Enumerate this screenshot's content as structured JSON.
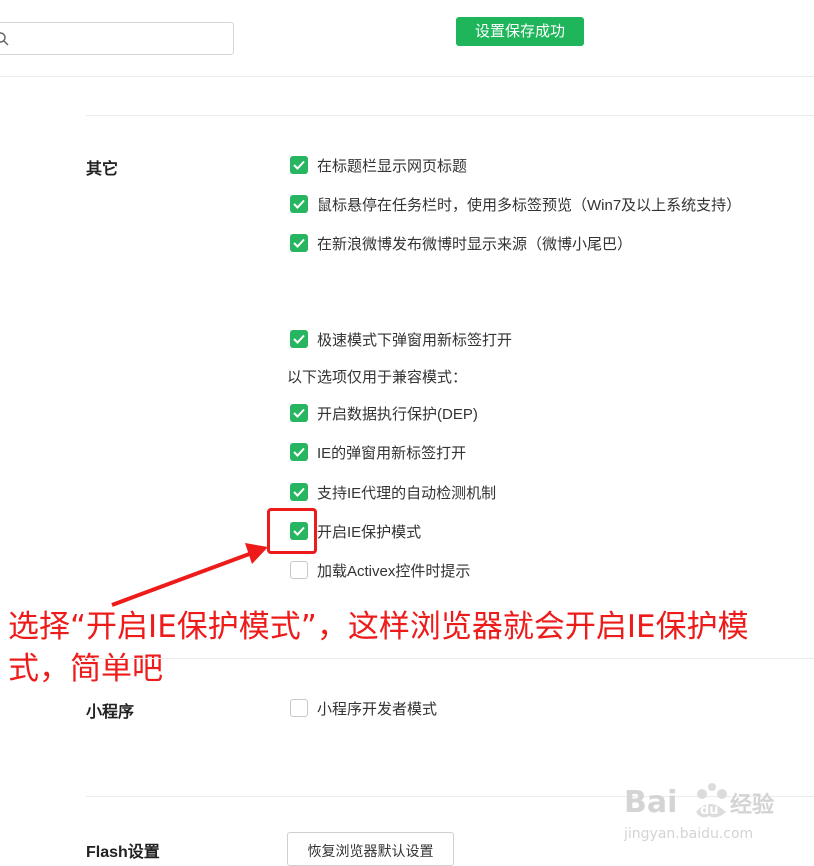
{
  "search": {
    "placeholder": "",
    "value": ""
  },
  "toast": {
    "label": "设置保存成功",
    "color": "#1fb55a"
  },
  "other_section": {
    "title": "其它",
    "options": [
      {
        "label": "在标题栏显示网页标题",
        "checked": true
      },
      {
        "label": "鼠标悬停在任务栏时，使用多标签预览（Win7及以上系统支持）",
        "checked": true
      },
      {
        "label": "在新浪微博发布微博时显示来源（微博小尾巴）",
        "checked": true
      }
    ],
    "speed_mode_option": {
      "label": "极速模式下弹窗用新标签打开",
      "checked": true
    },
    "compat_heading": "以下选项仅用于兼容模式：",
    "compat_options": [
      {
        "label": "开启数据执行保护(DEP)",
        "checked": true
      },
      {
        "label": "IE的弹窗用新标签打开",
        "checked": true
      },
      {
        "label": "支持IE代理的自动检测机制",
        "checked": true
      },
      {
        "label": "开启IE保护模式",
        "checked": true
      },
      {
        "label": "加载Activex控件时提示",
        "checked": false
      }
    ]
  },
  "annotation": {
    "text": "选择“开启IE保护模式”，这样浏览器就会开启IE保护模式，简单吧",
    "color": "#ee1b1b"
  },
  "miniprogram_section": {
    "title": "小程序",
    "option": {
      "label": "小程序开发者模式",
      "checked": false
    }
  },
  "flash_section": {
    "title": "Flash设置",
    "restore_button": "恢复浏览器默认设置"
  },
  "watermark": {
    "brand": "Bai du 经验",
    "url": "jingyan.baidu.com"
  },
  "colors": {
    "accent": "#27b562",
    "annotation": "#ee1b1b"
  }
}
